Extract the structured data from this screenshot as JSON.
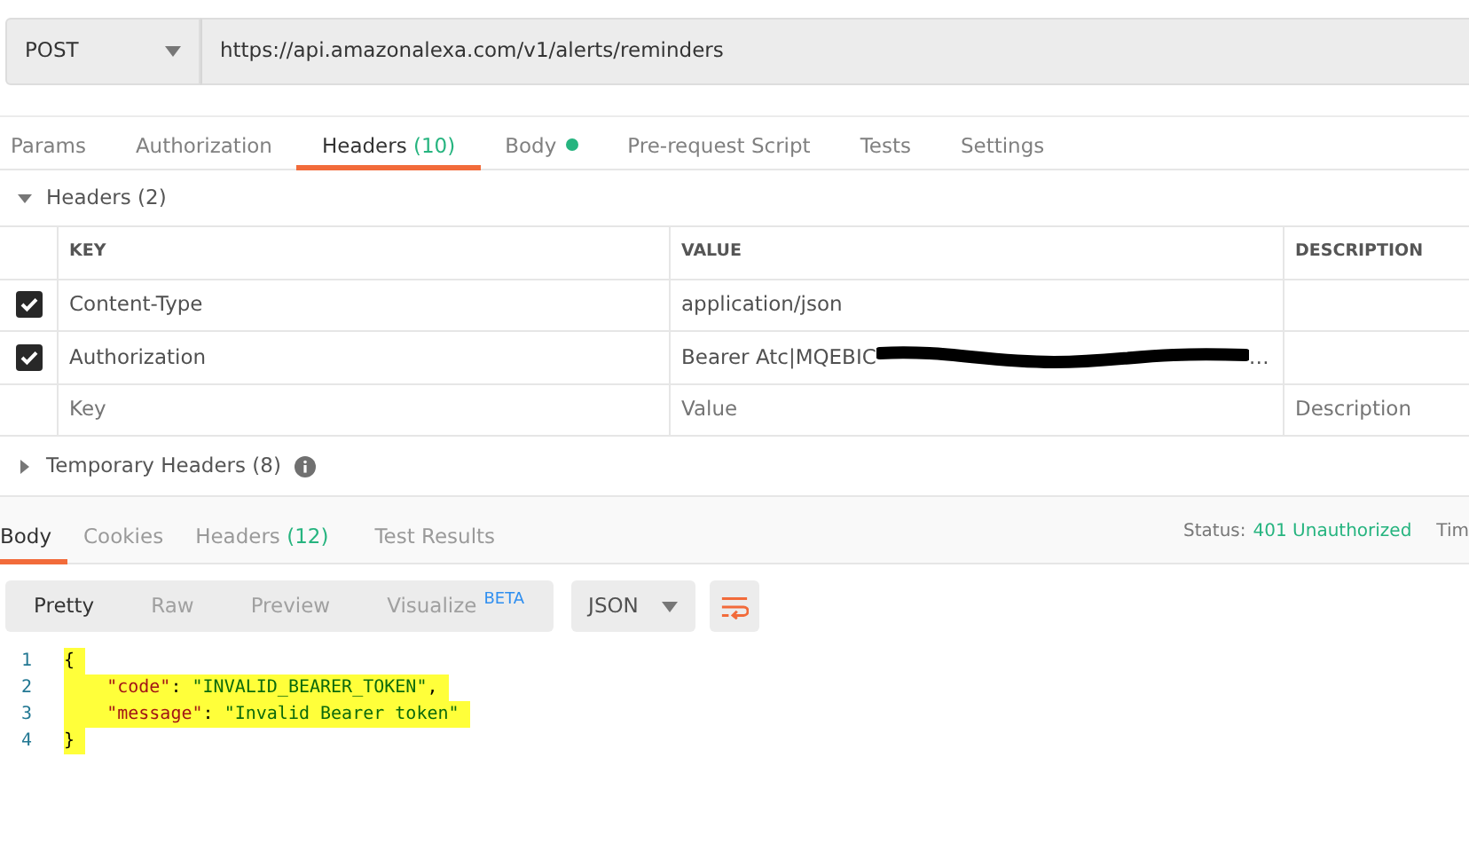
{
  "request": {
    "method": "POST",
    "url": "https://api.amazonalexa.com/v1/alerts/reminders"
  },
  "request_tabs": [
    {
      "label": "Params",
      "selected": false
    },
    {
      "label": "Authorization",
      "selected": false
    },
    {
      "label": "Headers",
      "count": "(10)",
      "selected": true
    },
    {
      "label": "Body",
      "dot": true,
      "selected": false
    },
    {
      "label": "Pre-request Script",
      "selected": false
    },
    {
      "label": "Tests",
      "selected": false
    },
    {
      "label": "Settings",
      "selected": false
    }
  ],
  "headers_section": {
    "title": "Headers (2)",
    "expanded": true
  },
  "table": {
    "columns": [
      "KEY",
      "VALUE",
      "DESCRIPTION"
    ],
    "rows": [
      {
        "checked": true,
        "key": "Content-Type",
        "value": "application/json"
      },
      {
        "checked": true,
        "key": "Authorization",
        "value": "Bearer Atc|MQEBIC",
        "redacted": true,
        "value_end": "…"
      }
    ],
    "new_row": {
      "key_placeholder": "Key",
      "value_placeholder": "Value",
      "description_placeholder": "Description"
    }
  },
  "temporary_headers": {
    "label": "Temporary Headers (8)",
    "expanded": false
  },
  "response_tabs": [
    {
      "label": "Body",
      "selected": true
    },
    {
      "label": "Cookies",
      "selected": false
    },
    {
      "label": "Headers",
      "count": "(12)",
      "selected": false
    },
    {
      "label": "Test Results",
      "selected": false
    }
  ],
  "status": {
    "label": "Status:",
    "value": "401 Unauthorized",
    "next": "Tim"
  },
  "view_modes": [
    {
      "label": "Pretty",
      "selected": true
    },
    {
      "label": "Raw",
      "selected": false
    },
    {
      "label": "Preview",
      "selected": false
    },
    {
      "label": "Visualize",
      "badge": "BETA",
      "selected": false
    }
  ],
  "format": "JSON",
  "code_lines": [
    {
      "number": "1",
      "tokens": [
        {
          "kind": "punct",
          "text": "{"
        }
      ]
    },
    {
      "number": "2",
      "tokens": [
        {
          "kind": "key",
          "text": "    \"code\""
        },
        {
          "kind": "punct",
          "text": ": "
        },
        {
          "kind": "string",
          "text": "\"INVALID_BEARER_TOKEN\""
        },
        {
          "kind": "punct",
          "text": ","
        }
      ]
    },
    {
      "number": "3",
      "tokens": [
        {
          "kind": "key",
          "text": "    \"message\""
        },
        {
          "kind": "punct",
          "text": ": "
        },
        {
          "kind": "string",
          "text": "\"Invalid Bearer token\""
        }
      ]
    },
    {
      "number": "4",
      "tokens": [
        {
          "kind": "punct",
          "text": "}"
        }
      ]
    }
  ]
}
